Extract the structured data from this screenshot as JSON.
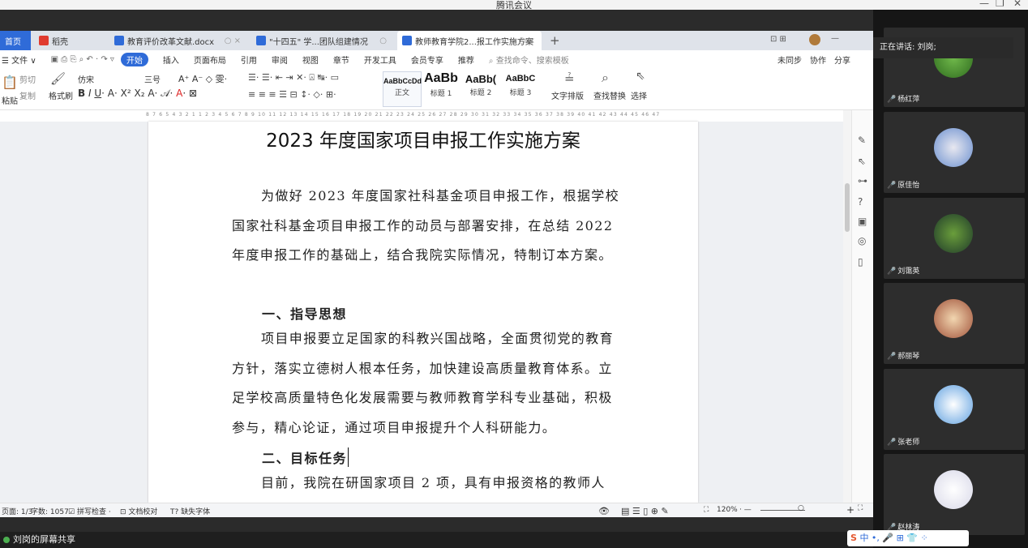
{
  "meeting": {
    "title": "腾讯会议",
    "minimize": "—",
    "restore": "❐",
    "close": "✕",
    "speaking_label": "正在讲话: 刘岗;",
    "share_label": "刘岗的屏幕共享"
  },
  "tabs": [
    {
      "label": "首页"
    },
    {
      "label": "稻壳"
    },
    {
      "label": "教育评价改革文献.docx"
    },
    {
      "label": "\"十四五\" 学...团队组建情况"
    },
    {
      "label": "教师教育学院2...报工作实施方案"
    }
  ],
  "menu": {
    "file": "☰ 文件 ∨",
    "items": [
      "开始",
      "插入",
      "页面布局",
      "引用",
      "审阅",
      "视图",
      "章节",
      "开发工具",
      "会员专享",
      "推荐"
    ],
    "active": "开始",
    "search_placeholder": "查找命令、搜索模板",
    "right": [
      "未同步",
      "协作",
      "分享"
    ]
  },
  "ribbon": {
    "cut": "剪切",
    "paste": "粘贴",
    "copy": "复制",
    "format_painter": "格式刷",
    "font": "仿宋",
    "font_size": "三号",
    "styles": [
      {
        "sample": "AaBbCcDd",
        "label": "正文"
      },
      {
        "sample": "AaBb",
        "label": "标题 1"
      },
      {
        "sample": "AaBb(",
        "label": "标题 2"
      },
      {
        "sample": "AaBbC",
        "label": "标题 3"
      }
    ],
    "text_layout": "文字排版",
    "find_replace": "查找替换",
    "select": "选择"
  },
  "ruler": "8 7 6 5 4 3 2 1 1 2 3 4 5 6 7 8 9 10 11 12 13 14 15 16 17 18 19 20 21 22 23 24 25 26 27 28 29 30 31 32 33 34 35 36 37 38 39 40 41 42 43 44 45 46 47",
  "document": {
    "title": "2023 年度国家项目申报工作实施方案",
    "p1": "为做好 2023 年度国家社科基金项目申报工作，根据学校国家社科基金项目申报工作的动员与部署安排，在总结 2022 年度申报工作的基础上，结合我院实际情况，特制订本方案。",
    "h1": "一、指导思想",
    "p2": "项目申报要立足国家的科教兴国战略，全面贯彻党的教育方针，落实立德树人根本任务，加快建设高质量教育体系。立足学校高质量特色化发展需要与教师教育学科专业基础，积极参与，精心论证，通过项目申报提升个人科研能力。",
    "h2": "二、目标任务",
    "p3": "目前，我院在研国家项目 2 项，具有申报资格的教师人"
  },
  "status": {
    "page": "页面: 1/3",
    "words": "字数: 1057",
    "spell": "拼写检查",
    "proof": "文档校对",
    "missing_font": "缺失字体",
    "zoom": "120%"
  },
  "participants": [
    {
      "name": "杨红萍"
    },
    {
      "name": "原佳怡"
    },
    {
      "name": "刘霭英"
    },
    {
      "name": "郝丽琴"
    },
    {
      "name": "张老师"
    },
    {
      "name": "赵林涛"
    }
  ],
  "ime": "中 •, 🎤 ⊞ 👕 ⁘"
}
